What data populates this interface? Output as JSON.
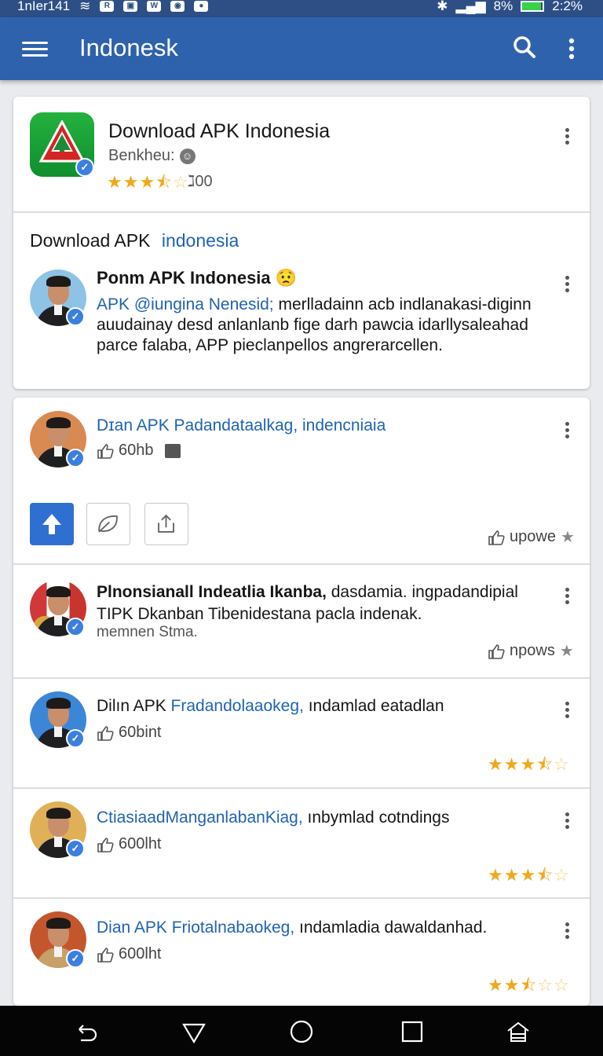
{
  "status_bar": {
    "carrier": "1nIer141",
    "percent_left": "8%",
    "time": "2:2%",
    "battery_level": 0.9
  },
  "app_bar": {
    "title": "Indonesk",
    "menu_icon": "hamburger-menu-icon",
    "search_icon": "search-icon",
    "more_icon": "more-vert-icon"
  },
  "app_header": {
    "title": "Download APK Indonesia",
    "subtitle": "Benkheu:",
    "rating": 3.5,
    "rating_count": "ℷ00"
  },
  "featured": {
    "section_title_black": "Download APK",
    "section_title_blue": "indonesia",
    "post": {
      "author": "Ponm APK Indonesia",
      "body_blue": "APK @iungina Nenesid;",
      "body_black": " merlladainn acb indlanakasi-diginn auudainay desd anlanlanb fige darh pawcia idarllysaleahad parce falaba, APP pieclanpellos angrerarcellen."
    }
  },
  "feed": [
    {
      "title_blue": "Dɪan APK Padandataalkag, indencniaia",
      "title_black": "",
      "likes": "60hb",
      "action_right": "upowe",
      "rating": null
    },
    {
      "title_black": "Plnonsianall Indeatlia Ikanba,",
      "title_rest": " dasdamia. ingpadandipial TIPK Dkanban Tibenidestana pacla indenak.",
      "meta": "memnen Stma.",
      "action_right": "npows"
    },
    {
      "title_black": "Dilın APK",
      "title_blue": " Fradandolaaokeg,",
      "title_rest": " ındamlad eatadlan",
      "likes": "60bint",
      "rating": 3.5
    },
    {
      "title_blue": "CtiasiaadManganlabanKiag,",
      "title_rest": " ınbymlad cotndings",
      "likes": "600lht",
      "rating": 3.5
    },
    {
      "title_blue": "Dian APK Friotalnabaokeg,",
      "title_rest": " ındamladia dawaldanhad.",
      "likes": "600lht",
      "rating": 2.5
    }
  ],
  "colors": {
    "app_bar": "#2f62ad",
    "status_bar": "#2d4f86",
    "link_blue": "#1f63b4",
    "star": "#f2a71b",
    "primary_button": "#2f6fd1"
  }
}
